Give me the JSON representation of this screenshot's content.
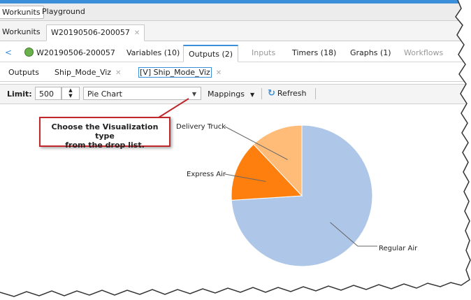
{
  "app_tabs": [
    {
      "label": "Workunits",
      "selected": true
    },
    {
      "label": "Playground",
      "selected": false
    }
  ],
  "workunit_tabs": {
    "list": "Workunits",
    "active": "W20190506-200057"
  },
  "detail_tabs": {
    "wuid": "W20190506-200057",
    "items": [
      "Variables (10)",
      "Outputs (2)",
      "Inputs",
      "Timers (18)",
      "Graphs (1)",
      "Workflows"
    ],
    "selected": "Outputs (2)"
  },
  "output_tabs": [
    "Outputs",
    "Ship_Mode_Viz",
    "[V] Ship_Mode_Viz"
  ],
  "toolbar": {
    "limit_label": "Limit:",
    "limit_value": "500",
    "chart_type": "Pie Chart",
    "mappings_label": "Mappings",
    "refresh_label": "Refresh"
  },
  "callout": {
    "line1": "Choose the Visualization type",
    "line2": "from the drop list."
  },
  "colors": {
    "accent": "#3a8fd8",
    "callout_border": "#c0282d",
    "slice_regular_air": "#aec7e8",
    "slice_express_air": "#ff7f0e",
    "slice_delivery_truck": "#ffbb78"
  },
  "chart_data": {
    "type": "pie",
    "categories": [
      "Regular Air",
      "Express Air",
      "Delivery Truck"
    ],
    "values": [
      74,
      14,
      12
    ]
  }
}
